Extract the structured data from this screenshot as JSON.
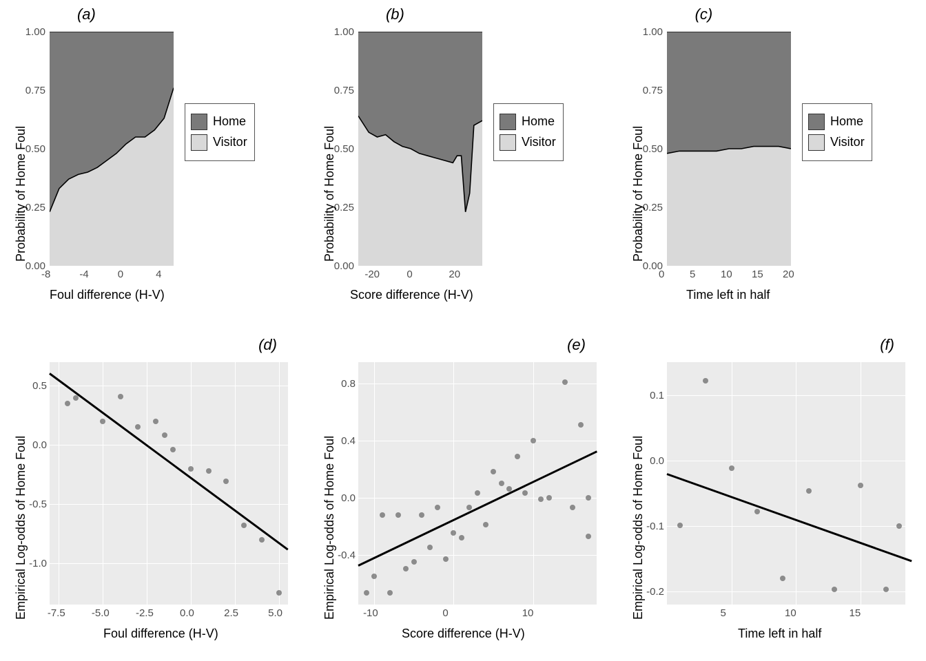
{
  "legend": {
    "home": "Home",
    "visitor": "Visitor"
  },
  "ylab_top": "Probability of Home Foul",
  "ylab_bottom": "Empirical Log-odds of Home Foul",
  "panels": {
    "a": {
      "title": "(a)",
      "xlab": "Foul difference (H-V)"
    },
    "b": {
      "title": "(b)",
      "xlab": "Score difference (H-V)"
    },
    "c": {
      "title": "(c)",
      "xlab": "Time left in half"
    },
    "d": {
      "title": "(d)",
      "xlab": "Foul difference (H-V)"
    },
    "e": {
      "title": "(e)",
      "xlab": "Score difference (H-V)"
    },
    "f": {
      "title": "(f)",
      "xlab": "Time left in half"
    }
  },
  "chart_data": [
    {
      "id": "a",
      "type": "area",
      "title": "(a)",
      "xlabel": "Foul difference (H-V)",
      "ylabel": "Probability of Home Foul",
      "xlim": [
        -8,
        5
      ],
      "ylim": [
        0,
        1
      ],
      "x_ticks": [
        -8,
        -4,
        0,
        4
      ],
      "y_ticks": [
        0.0,
        0.25,
        0.5,
        0.75,
        1.0
      ],
      "series": [
        {
          "name": "Home",
          "color": "#7a7a7a",
          "stacked_above": true
        },
        {
          "name": "Visitor",
          "color": "#d9d9d9",
          "stacked_above": false
        }
      ],
      "boundary": {
        "x": [
          -8,
          -7,
          -6,
          -5,
          -4,
          -3,
          -2,
          -1,
          0,
          1,
          2,
          3,
          4,
          5
        ],
        "y": [
          0.23,
          0.33,
          0.37,
          0.39,
          0.4,
          0.42,
          0.45,
          0.48,
          0.52,
          0.55,
          0.55,
          0.58,
          0.63,
          0.76
        ]
      }
    },
    {
      "id": "b",
      "type": "area",
      "title": "(b)",
      "xlabel": "Score difference (H-V)",
      "ylabel": "Probability of Home Foul",
      "xlim": [
        -27,
        32
      ],
      "ylim": [
        0,
        1
      ],
      "x_ticks": [
        -20,
        0,
        20
      ],
      "y_ticks": [
        0.0,
        0.25,
        0.5,
        0.75,
        1.0
      ],
      "series": [
        {
          "name": "Home",
          "color": "#7a7a7a",
          "stacked_above": true
        },
        {
          "name": "Visitor",
          "color": "#d9d9d9",
          "stacked_above": false
        }
      ],
      "boundary": {
        "x": [
          -27,
          -22,
          -18,
          -14,
          -10,
          -6,
          -2,
          2,
          6,
          10,
          14,
          18,
          20,
          22,
          24,
          26,
          28,
          32
        ],
        "y": [
          0.64,
          0.57,
          0.55,
          0.56,
          0.53,
          0.51,
          0.5,
          0.48,
          0.47,
          0.46,
          0.45,
          0.44,
          0.47,
          0.47,
          0.23,
          0.31,
          0.6,
          0.62
        ]
      }
    },
    {
      "id": "c",
      "type": "area",
      "title": "(c)",
      "xlabel": "Time left in half",
      "ylabel": "Probability of Home Foul",
      "xlim": [
        0,
        20
      ],
      "ylim": [
        0,
        1
      ],
      "x_ticks": [
        0,
        5,
        10,
        15,
        20
      ],
      "y_ticks": [
        0.0,
        0.25,
        0.5,
        0.75,
        1.0
      ],
      "series": [
        {
          "name": "Home",
          "color": "#7a7a7a",
          "stacked_above": true
        },
        {
          "name": "Visitor",
          "color": "#d9d9d9",
          "stacked_above": false
        }
      ],
      "boundary": {
        "x": [
          0,
          2,
          4,
          6,
          8,
          10,
          12,
          14,
          16,
          18,
          20
        ],
        "y": [
          0.48,
          0.49,
          0.49,
          0.49,
          0.49,
          0.5,
          0.5,
          0.51,
          0.51,
          0.51,
          0.5
        ]
      }
    },
    {
      "id": "d",
      "type": "scatter",
      "title": "(d)",
      "xlabel": "Foul difference (H-V)",
      "ylabel": "Empirical Log-odds of Home Foul",
      "xlim": [
        -8,
        5.5
      ],
      "ylim": [
        -1.35,
        0.7
      ],
      "x_ticks": [
        -7.5,
        -5.0,
        -2.5,
        0.0,
        2.5,
        5.0
      ],
      "y_ticks": [
        -1.0,
        -0.5,
        0.0,
        0.5
      ],
      "points": {
        "x": [
          -7,
          -6.5,
          -5,
          -4,
          -3,
          -2,
          -1.5,
          -1,
          0,
          1,
          2,
          3,
          4,
          5
        ],
        "y": [
          0.35,
          0.4,
          0.2,
          0.41,
          0.15,
          0.2,
          0.08,
          -0.04,
          -0.2,
          -0.22,
          -0.31,
          -0.68,
          -0.8,
          -1.25
        ]
      },
      "fit_line": {
        "x": [
          -8,
          5.5
        ],
        "y": [
          0.61,
          -0.88
        ]
      }
    },
    {
      "id": "e",
      "type": "scatter",
      "title": "(e)",
      "xlabel": "Score difference (H-V)",
      "ylabel": "Empirical Log-odds of Home Foul",
      "xlim": [
        -12,
        18
      ],
      "ylim": [
        -0.75,
        0.95
      ],
      "x_ticks": [
        -10,
        0,
        10
      ],
      "y_ticks": [
        -0.4,
        0.0,
        0.4,
        0.8
      ],
      "points": {
        "x": [
          -11,
          -10,
          -9,
          -8,
          -7,
          -6,
          -5,
          -4,
          -3,
          -2,
          -1,
          0,
          1,
          2,
          3,
          4,
          5,
          6,
          7,
          8,
          9,
          10,
          11,
          12,
          14,
          15,
          16,
          17,
          17
        ],
        "y": [
          -0.67,
          -0.55,
          -0.12,
          -0.67,
          -0.12,
          -0.5,
          -0.45,
          -0.12,
          -0.35,
          -0.07,
          -0.43,
          -0.25,
          -0.28,
          -0.07,
          0.03,
          -0.19,
          0.18,
          0.1,
          0.06,
          0.29,
          0.03,
          0.4,
          -0.01,
          0.0,
          0.81,
          -0.07,
          0.51,
          -0.27,
          0.0
        ]
      },
      "fit_line": {
        "x": [
          -12,
          18
        ],
        "y": [
          -0.47,
          0.33
        ]
      }
    },
    {
      "id": "f",
      "type": "scatter",
      "title": "(f)",
      "xlabel": "Time left in half",
      "ylabel": "Empirical Log-odds of Home Foul",
      "xlim": [
        0,
        18.5
      ],
      "ylim": [
        -0.22,
        0.15
      ],
      "x_ticks": [
        5,
        10,
        15
      ],
      "y_ticks": [
        -0.2,
        -0.1,
        0.0,
        0.1
      ],
      "points": {
        "x": [
          1,
          3,
          5,
          7,
          9,
          11,
          13,
          15,
          17,
          18
        ],
        "y": [
          -0.099,
          0.122,
          -0.012,
          -0.078,
          -0.18,
          -0.047,
          -0.197,
          -0.038,
          -0.197,
          -0.1
        ]
      },
      "fit_line": {
        "x": [
          0,
          19
        ],
        "y": [
          -0.019,
          -0.152
        ]
      }
    }
  ]
}
